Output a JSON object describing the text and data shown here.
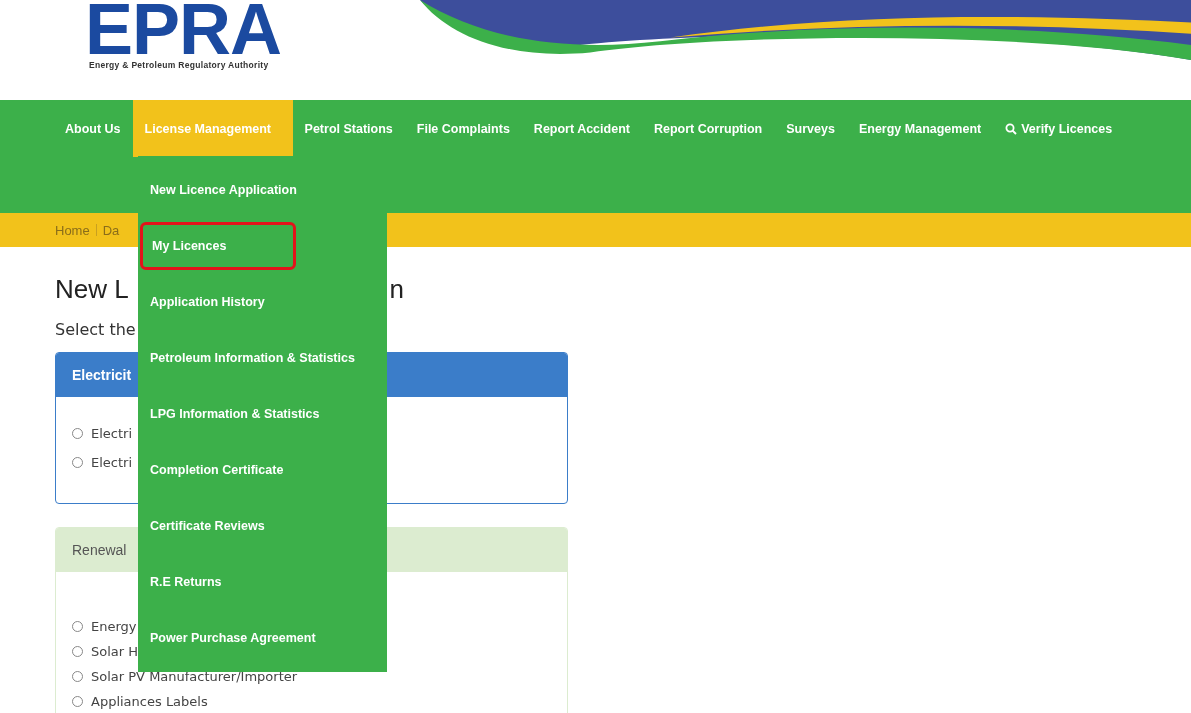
{
  "header": {
    "logo_text": "EPRA",
    "logo_tagline": "Energy & Petroleum Regulatory Authority"
  },
  "nav": [
    {
      "label": "About Us",
      "kind": "link",
      "selected": false
    },
    {
      "label": "License Management",
      "kind": "link",
      "selected": true
    },
    {
      "label": "Petrol Stations",
      "kind": "link",
      "selected": false
    },
    {
      "label": "File Complaints",
      "kind": "link",
      "selected": false
    },
    {
      "label": "Report Accident",
      "kind": "link",
      "selected": false
    },
    {
      "label": "Report Corruption",
      "kind": "link",
      "selected": false
    },
    {
      "label": "Surveys",
      "kind": "link",
      "selected": false
    },
    {
      "label": "Energy Management",
      "kind": "link",
      "selected": false
    },
    {
      "label": "Verify Licences",
      "kind": "search",
      "selected": false
    }
  ],
  "dropdown": [
    {
      "label": "New Licence Application",
      "highlighted": false
    },
    {
      "label": "My Licences",
      "highlighted": true
    },
    {
      "label": "Application History",
      "highlighted": false
    },
    {
      "label": "Petroleum Information & Statistics",
      "highlighted": false
    },
    {
      "label": "LPG Information & Statistics",
      "highlighted": false
    },
    {
      "label": "Completion Certificate",
      "highlighted": false
    },
    {
      "label": "Certificate Reviews",
      "highlighted": false
    },
    {
      "label": "R.E Returns",
      "highlighted": false
    },
    {
      "label": "Power Purchase Agreement",
      "highlighted": false
    }
  ],
  "breadcrumb": [
    "Home",
    "Da"
  ],
  "page_title": {
    "start": "New L",
    "end": "n"
  },
  "subtitle": "Select the",
  "panels": [
    {
      "title": "Electricit",
      "color": "#3b7dc9",
      "options": [
        {
          "label": "Electri",
          "selected": false
        },
        {
          "label": "Electri",
          "selected": false
        }
      ]
    },
    {
      "title": "Renewal",
      "color": "#dcecd0",
      "options": [
        {
          "label": "Energy",
          "selected": false
        },
        {
          "label": "Solar H",
          "selected": false
        },
        {
          "label": "Solar PV Manufacturer/Importer",
          "selected": false
        },
        {
          "label": "Appliances Labels",
          "selected": false
        }
      ]
    }
  ]
}
